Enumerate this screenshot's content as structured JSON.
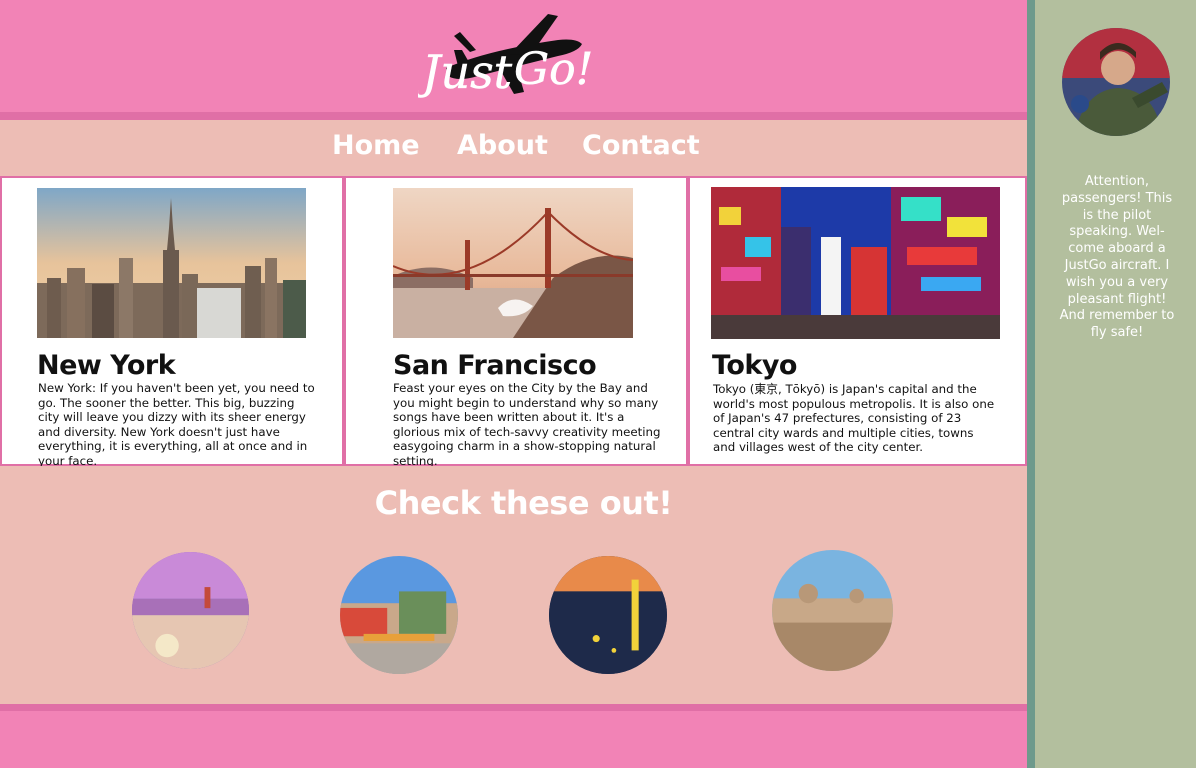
{
  "logo": {
    "text_left": "Just",
    "text_right": "Go!"
  },
  "nav": {
    "items": [
      {
        "label": "Home"
      },
      {
        "label": "About"
      },
      {
        "label": "Contact"
      }
    ]
  },
  "cards": [
    {
      "title": "New York",
      "body": "New York: If you haven't been yet, you need to go. The sooner the better. This big, buzzing city will leave you dizzy with its sheer energy and diversity. New York doesn't just have everything, it is everything, all at once and in your face."
    },
    {
      "title": "San Francisco",
      "body": "Feast your eyes on the City by the Bay and you might begin to understand why so many songs have been written about it. It's a glorious mix of tech-savvy creativity meeting easygoing charm in a show-stopping natural setting."
    },
    {
      "title": "Tokyo",
      "body": "Tokyo (東京, Tōkyō) is Japan's capital and the world's most populous metropolis. It is also one of Japan's 47 prefectures, consisting of 23 central city wards and multiple cities, towns and villages west of the city center."
    }
  ],
  "explore": {
    "title": "Check these out!"
  },
  "sidebar": {
    "message": "Attention, passengers! This is the pilot speaking. Wel-come aboard a JustGo aircraft. I wish you a very pleasant flight! And remember to fly safe!"
  },
  "colors": {
    "header_pink": "#f283b6",
    "stripe_pink": "#e06fa6",
    "nav_blush": "#edbdb5",
    "sidebar_sage": "#b3bf9e",
    "sidebar_border": "#6e9a8c"
  }
}
